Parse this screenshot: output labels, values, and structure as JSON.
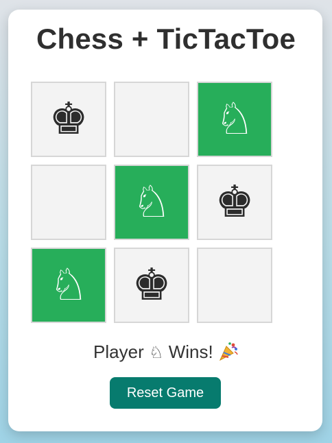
{
  "game": {
    "title": "Chess + TicTacToe",
    "board": [
      {
        "piece": "♚",
        "icon": "black-king-icon",
        "highlight": false
      },
      {
        "piece": "",
        "icon": "",
        "highlight": false
      },
      {
        "piece": "♘",
        "icon": "white-knight-icon",
        "highlight": true
      },
      {
        "piece": "",
        "icon": "",
        "highlight": false
      },
      {
        "piece": "♘",
        "icon": "white-knight-icon",
        "highlight": true
      },
      {
        "piece": "♚",
        "icon": "black-king-icon",
        "highlight": false
      },
      {
        "piece": "♘",
        "icon": "white-knight-icon",
        "highlight": true
      },
      {
        "piece": "♚",
        "icon": "black-king-icon",
        "highlight": false
      },
      {
        "piece": "",
        "icon": "",
        "highlight": false
      }
    ],
    "status": {
      "prefix": "Player",
      "winner_piece": "♘",
      "suffix": "Wins!",
      "emoji_icon": "party-popper-icon"
    },
    "reset_label": "Reset Game"
  },
  "colors": {
    "win_cell": "#27ae5a",
    "cell": "#f3f3f3",
    "button": "#077b6e",
    "title": "#2f2f2f"
  }
}
